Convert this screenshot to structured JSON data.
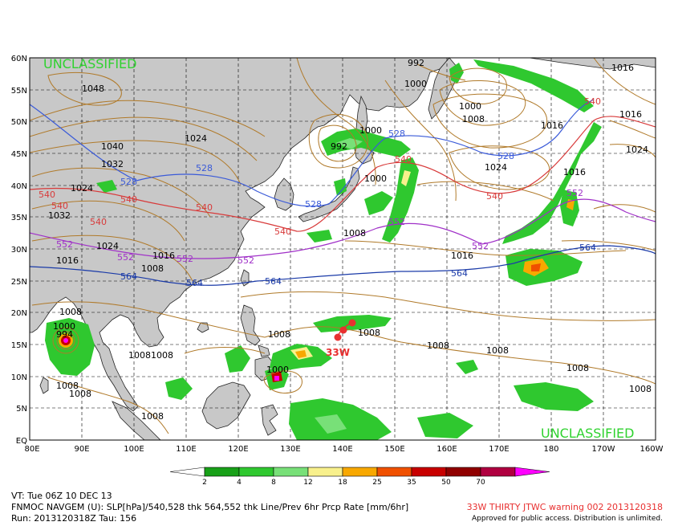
{
  "map": {
    "classification_top": "UNCLASSIFIED",
    "classification_bottom": "UNCLASSIFIED",
    "lat_labels": [
      "60N",
      "55N",
      "50N",
      "45N",
      "40N",
      "35N",
      "30N",
      "25N",
      "20N",
      "15N",
      "10N",
      "5N",
      "EQ"
    ],
    "lon_labels": [
      "80E",
      "90E",
      "100E",
      "110E",
      "120E",
      "130E",
      "140E",
      "150E",
      "160E",
      "170E",
      "180",
      "170W",
      "160W"
    ],
    "storm_label": "33W",
    "colors": {
      "land": "#c8c8c8",
      "isobar": "#b07a2a",
      "thk_528": "#3a5ad8",
      "thk_540": "#d83a3a",
      "thk_552": "#a030c8",
      "thk_564": "#1a3aa8",
      "storm": "#e83030",
      "classification": "#2fd22f"
    },
    "isobar_labels": [
      "1048",
      "1040",
      "1032",
      "1024",
      "1024",
      "1032",
      "1024",
      "1016",
      "1016",
      "1008",
      "1008",
      "1000",
      "994",
      "1008",
      "1008",
      "1008",
      "1008",
      "1008",
      "1000",
      "1008",
      "1008",
      "1008",
      "1008",
      "1008",
      "992",
      "1000",
      "1008",
      "1000",
      "992",
      "1000",
      "1008",
      "1016",
      "1016",
      "1016",
      "1024",
      "1024",
      "1016",
      "1016",
      "1000",
      "1008"
    ],
    "thickness_labels": {
      "t528": [
        "528",
        "528",
        "528",
        "528",
        "528"
      ],
      "t540": [
        "540",
        "540",
        "540",
        "540",
        "540",
        "540",
        "540",
        "540",
        "540"
      ],
      "t552": [
        "552",
        "552",
        "552",
        "552",
        "552",
        "552",
        "552"
      ],
      "t564": [
        "564",
        "564",
        "564",
        "564",
        "564"
      ]
    }
  },
  "colorbar": {
    "ticks": [
      "2",
      "4",
      "8",
      "12",
      "18",
      "25",
      "35",
      "50",
      "70"
    ],
    "colors": [
      "#ffffff",
      "#18a018",
      "#2fc82f",
      "#78e078",
      "#f8f08c",
      "#f8a800",
      "#f05000",
      "#c80000",
      "#900000",
      "#b00040",
      "#ff00ff"
    ]
  },
  "footer": {
    "vt": "VT: Tue 06Z 10 DEC 13",
    "desc": "FNMOC NAVGEM (U): SLP[hPa]/540,528 thk 564,552 thk Line/Prev 6hr Prcp Rate [mm/6hr]",
    "run": "Run: 2013120318Z Tau: 156",
    "warning": "33W THIRTY JTWC warning 002 2013120318",
    "approved": "Approved for public access. Distribution is unlimited."
  }
}
